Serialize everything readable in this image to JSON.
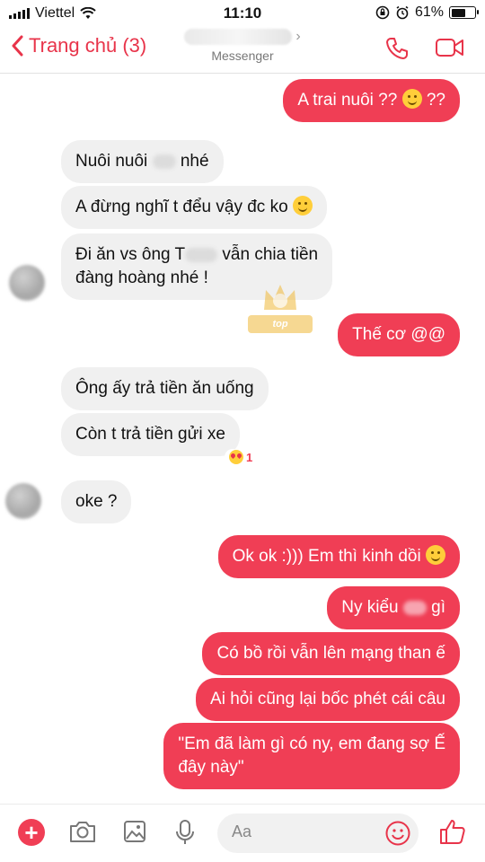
{
  "status_bar": {
    "carrier": "Viettel",
    "time": "11:10",
    "battery": "61%",
    "battery_level": 0.61
  },
  "header": {
    "back_label": "Trang chủ (3)",
    "subtitle": "Messenger"
  },
  "colors": {
    "accent": "#f03e55",
    "incoming_bubble": "#f0f0f0"
  },
  "messages": {
    "m1": "A trai nuôi ?? ",
    "m1_tail": " ??",
    "m2a": "Nuôi nuôi ",
    "m2b": " nhé",
    "m3": "A đừng nghĩ t đểu vậy đc ko ",
    "m4a": "Đi ăn vs ông T",
    "m4b": " vẫn chia tiền",
    "m4c": "đàng hoàng nhé !",
    "m5": "Thế cơ @@",
    "m6": "Ông ấy trả tiền ăn uống",
    "m7": "Còn t trả tiền gửi xe",
    "m7_reaction_count": "1",
    "m8": "oke ?",
    "m9": "Ok ok :))) Em thì kinh dồi ",
    "m10a": "Ny kiểu ",
    "m10b": " gì",
    "m11": "Có bồ rồi vẫn lên mạng than ế",
    "m12": "Ai hỏi cũng lại bốc phét cái câu",
    "m13a": "\"Em đã làm gì có ny, em đang sợ Ế",
    "m13b": "đây này\""
  },
  "watermark": {
    "text": "top COMMENTS"
  },
  "composer": {
    "placeholder": "Aa"
  },
  "icons": [
    "back-chevron-icon",
    "phone-icon",
    "video-icon",
    "plus-icon",
    "camera-icon",
    "image-icon",
    "microphone-icon",
    "emoji-icon",
    "like-icon"
  ]
}
